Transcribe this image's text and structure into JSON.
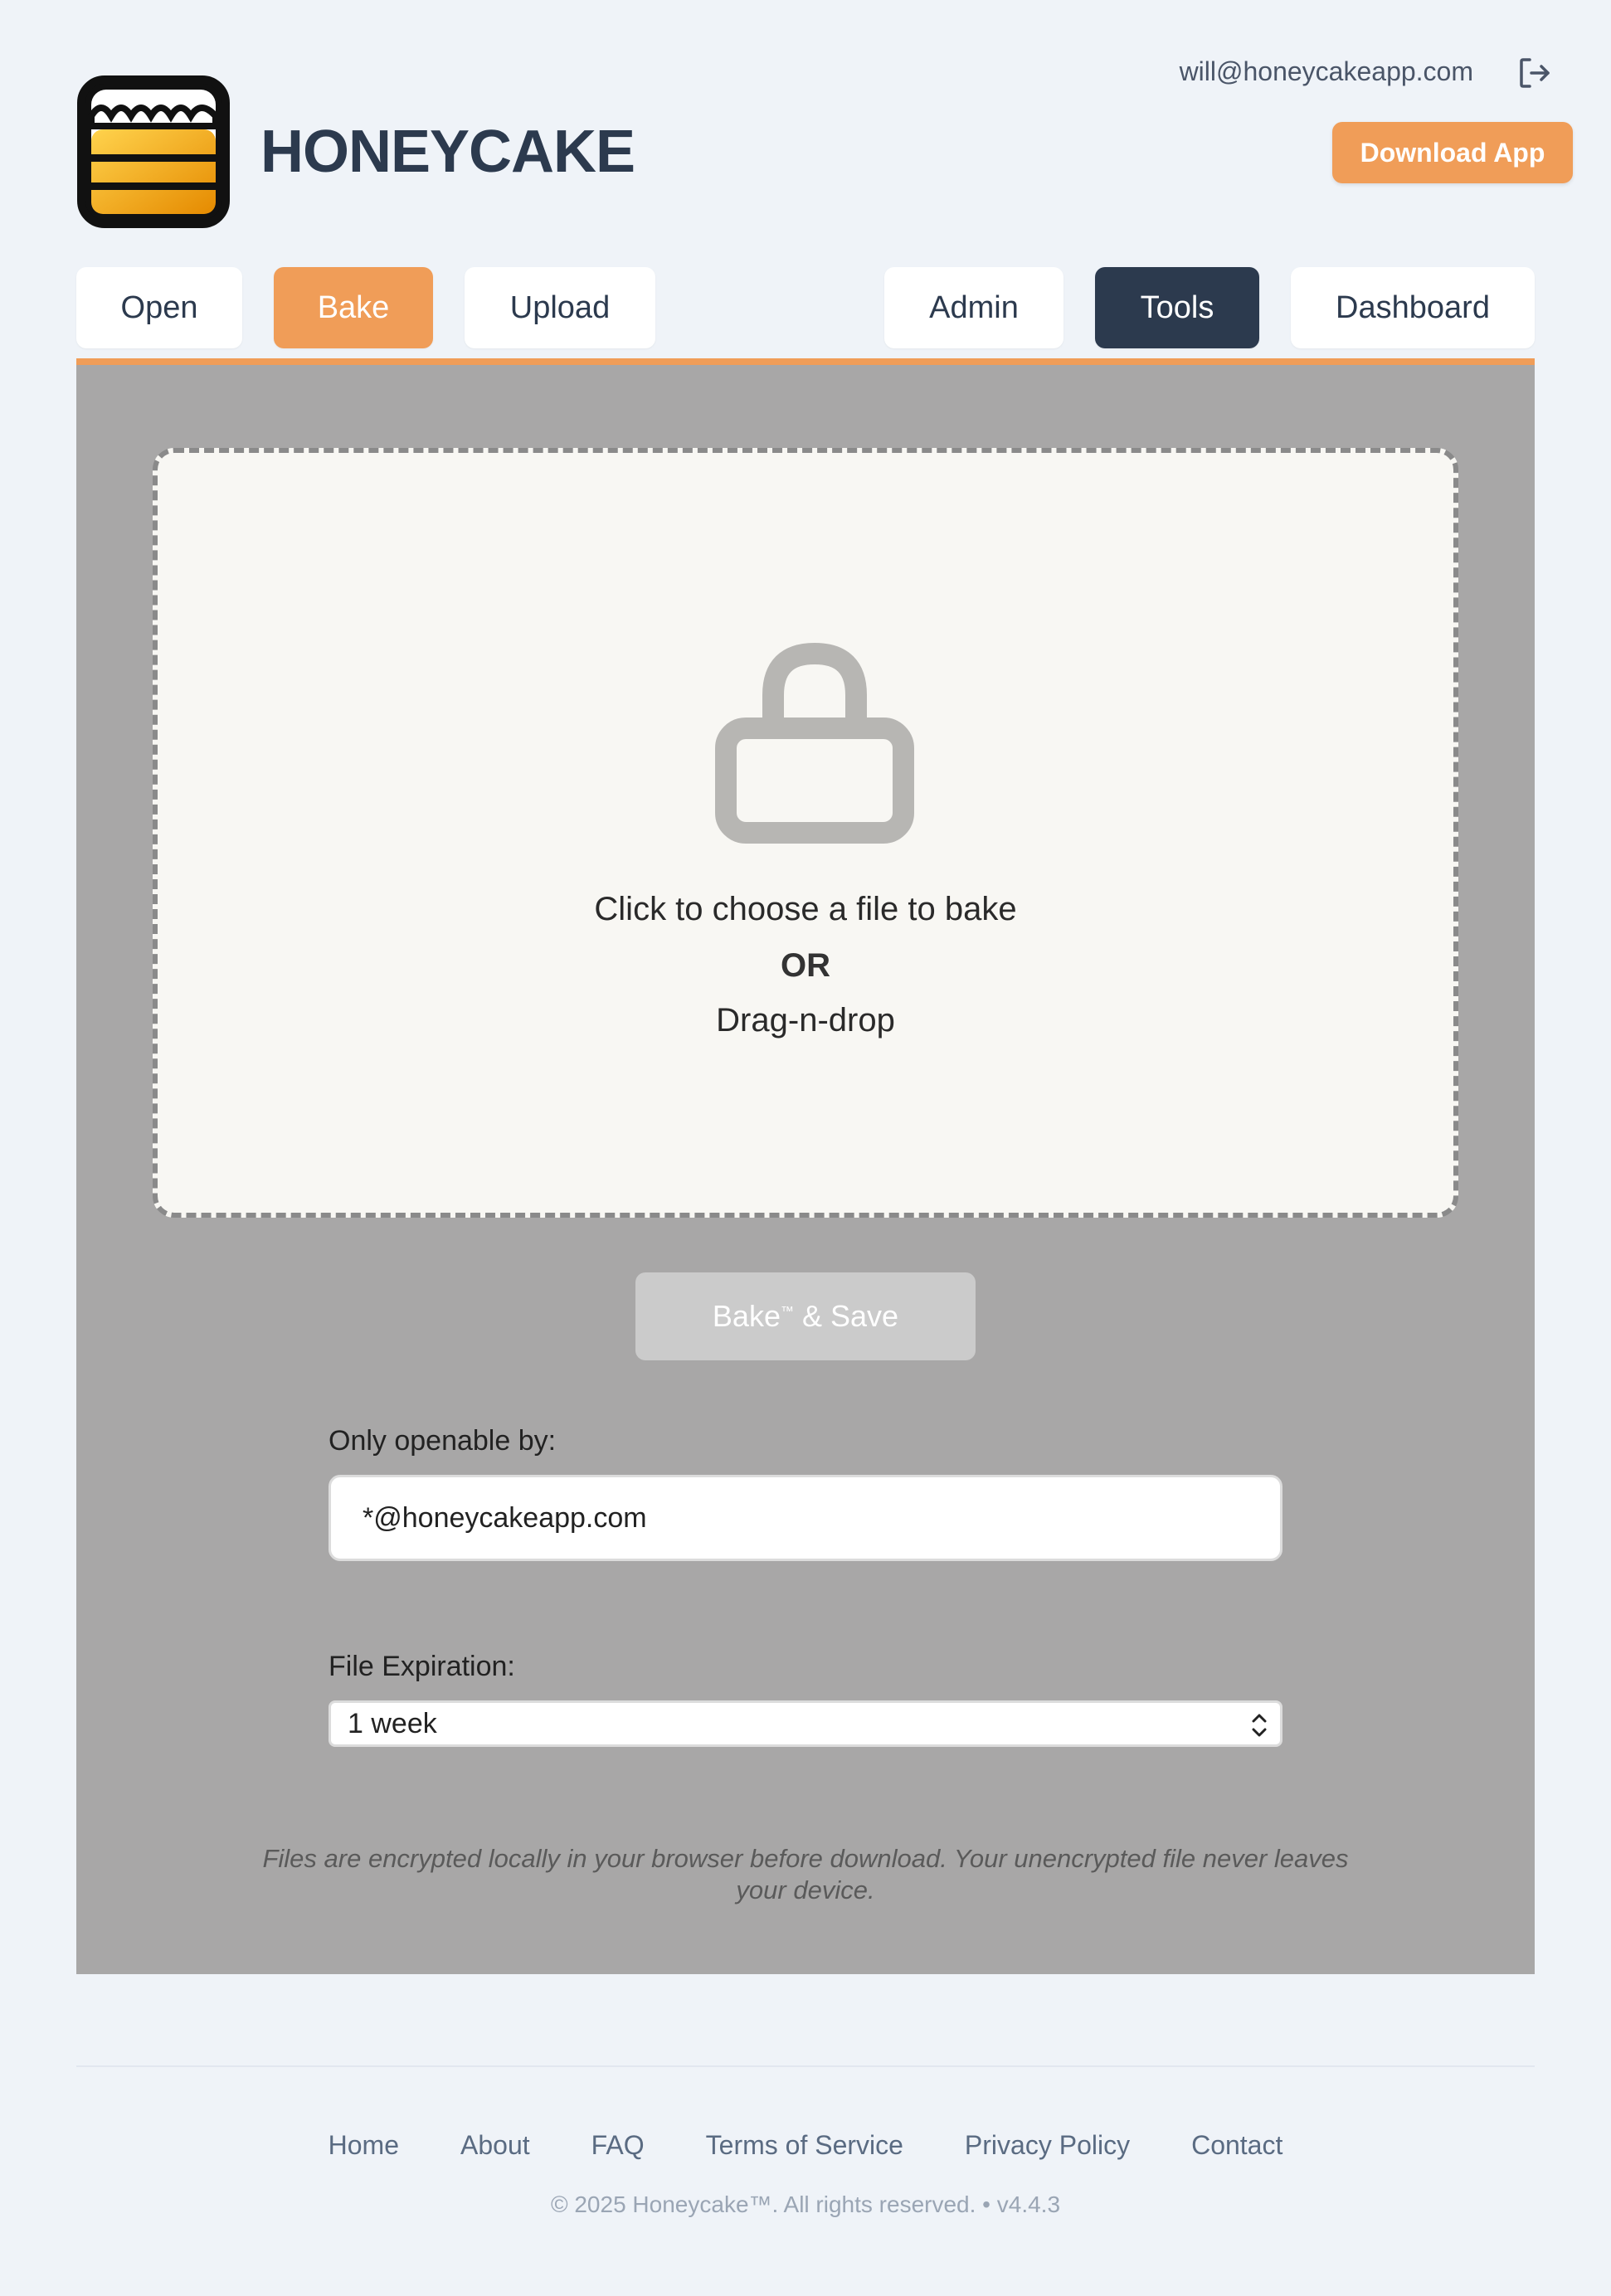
{
  "header": {
    "brand": "HONEYCAKE",
    "user_email": "will@honeycakeapp.com",
    "download_label": "Download App",
    "logout_icon": "logout-icon"
  },
  "nav": {
    "tabs": [
      {
        "label": "Open",
        "active": false
      },
      {
        "label": "Bake",
        "active": true
      },
      {
        "label": "Upload",
        "active": false
      },
      {
        "label": "Admin",
        "active": false
      },
      {
        "label": "Tools",
        "active": false,
        "highlighted": true
      },
      {
        "label": "Dashboard",
        "active": false
      }
    ]
  },
  "dropzone": {
    "icon": "lock-icon",
    "line1": "Click to choose a file to bake",
    "or": "OR",
    "line2": "Drag-n-drop"
  },
  "bake_button": {
    "label": "Bake",
    "tm": "™",
    "suffix": " & Save",
    "disabled": true
  },
  "form": {
    "openable_label": "Only openable by:",
    "openable_value": "*@honeycakeapp.com",
    "expiration_label": "File Expiration:",
    "expiration_value": "1 week"
  },
  "disclaimer": "Files are encrypted locally in your browser before download. Your unencrypted file never leaves your device.",
  "footer": {
    "links": [
      "Home",
      "About",
      "FAQ",
      "Terms of Service",
      "Privacy Policy",
      "Contact"
    ],
    "copyright": "© 2025 Honeycake™. All rights reserved. • v4.4.3"
  },
  "colors": {
    "accent": "#f09d58",
    "dark": "#2c3a4e",
    "panel": "#a8a7a7",
    "background": "#eff3f8"
  }
}
